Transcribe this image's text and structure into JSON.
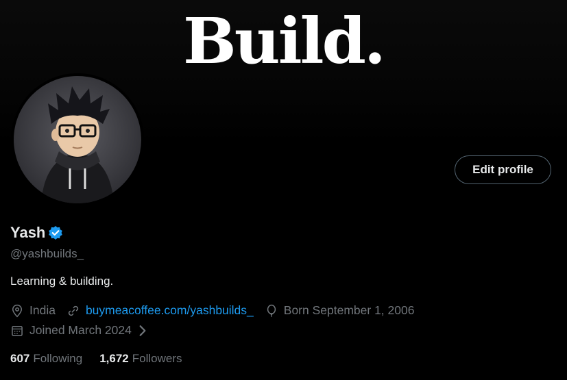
{
  "banner": {
    "title": "Build."
  },
  "profile": {
    "display_name": "Yash",
    "handle": "@yashbuilds_",
    "bio": "Learning & building.",
    "edit_button": "Edit profile",
    "location": "India",
    "website": "buymeacoffee.com/yashbuilds_",
    "birthday": "Born September 1, 2006",
    "joined": "Joined March 2024"
  },
  "stats": {
    "following_count": "607",
    "following_label": "Following",
    "followers_count": "1,672",
    "followers_label": "Followers"
  },
  "icons": {
    "location": "location-pin-icon",
    "link": "link-icon",
    "birthday": "balloon-icon",
    "joined": "calendar-icon",
    "verified": "verified-badge-icon"
  },
  "colors": {
    "background": "#000000",
    "text": "#e7e9ea",
    "muted": "#71767b",
    "link": "#1d9bf0",
    "border": "#536471"
  }
}
